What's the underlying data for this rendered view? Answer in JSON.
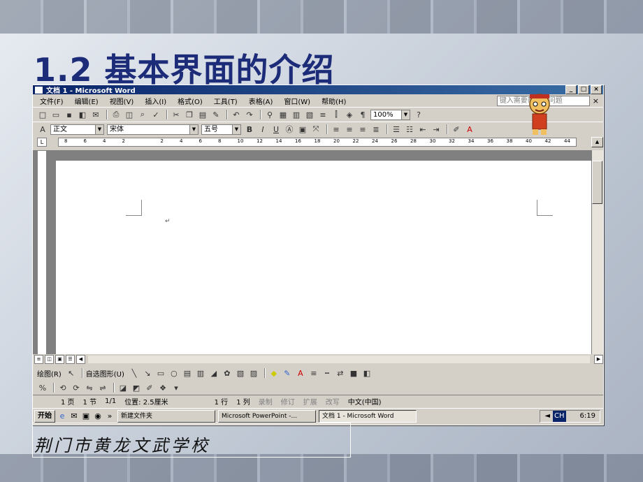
{
  "slide": {
    "title": "1.2  基本界面的介绍",
    "footer": "荆门市黄龙文武学校"
  },
  "window": {
    "title": "文档 1 - Microsoft Word",
    "controls": [
      "_",
      "□",
      "×"
    ]
  },
  "menu": {
    "items": [
      "文件(F)",
      "编辑(E)",
      "视图(V)",
      "插入(I)",
      "格式(O)",
      "工具(T)",
      "表格(A)",
      "窗口(W)",
      "帮助(H)"
    ],
    "help_placeholder": "键入需要帮助的问题",
    "close_doc": "×"
  },
  "standard_toolbar": {
    "zoom": "100%"
  },
  "format_toolbar": {
    "style": "正文",
    "font": "宋体",
    "size": "五号",
    "bold": "B",
    "italic": "I",
    "underline": "U"
  },
  "ruler": {
    "ticks": [
      "8",
      "6",
      "4",
      "2",
      "",
      "2",
      "4",
      "6",
      "8",
      "10",
      "12",
      "14",
      "16",
      "18",
      "20",
      "22",
      "24",
      "26",
      "28",
      "30",
      "32",
      "34",
      "36",
      "38",
      "40",
      "42",
      "44"
    ]
  },
  "drawing_toolbar": {
    "draw_label": "绘图(R)",
    "autoshape_label": "自选图形(U)"
  },
  "statusbar": {
    "page": "1 页",
    "section": "1 节",
    "pages": "1/1",
    "position": "位置: 2.5厘米",
    "line": "1 行",
    "column": "1 列",
    "rec": "录制",
    "trk": "修订",
    "ext": "扩展",
    "ovr": "改写",
    "lang": "中文(中国)"
  },
  "taskbar": {
    "start": "开始",
    "more": "»",
    "items": [
      "新建文件夹",
      "Microsoft PowerPoint -...",
      "文档 1 - Microsoft Word"
    ],
    "time": "6:19",
    "ime": "CH"
  }
}
